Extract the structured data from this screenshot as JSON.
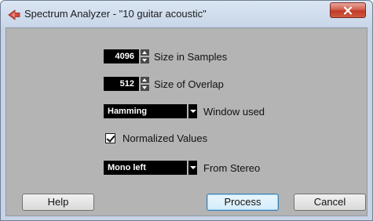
{
  "window": {
    "title": "Spectrum Analyzer - \"10 guitar acoustic\"",
    "app_icon": "cubase-arrow-icon",
    "close_icon": "close-x-icon"
  },
  "settings": {
    "size_in_samples": {
      "value": "4096",
      "label": "Size in Samples"
    },
    "size_of_overlap": {
      "value": "512",
      "label": "Size of Overlap"
    },
    "window_used": {
      "value": "Hamming",
      "label": "Window used"
    },
    "normalized_values": {
      "checked": true,
      "label": "Normalized Values"
    },
    "from_stereo": {
      "value": "Mono left",
      "label": "From Stereo"
    }
  },
  "buttons": {
    "help": "Help",
    "process": "Process",
    "cancel": "Cancel"
  },
  "colors": {
    "accent_icon": "#d8473b",
    "close_button": "#c23b28",
    "dialog_background": "#b4b4b4",
    "field_background": "#000000"
  }
}
